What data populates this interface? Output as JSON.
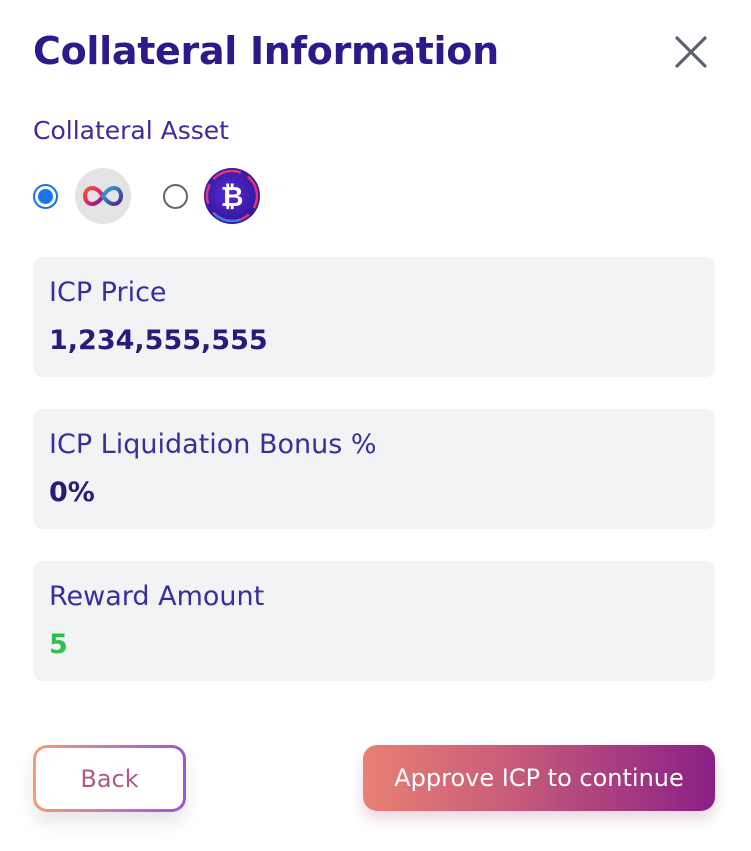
{
  "modal": {
    "title": "Collateral Information",
    "close_icon": "close-icon"
  },
  "collateral_asset": {
    "label": "Collateral Asset",
    "options": [
      {
        "icon": "icp-infinity-icon",
        "selected": true
      },
      {
        "icon": "ckbtc-bitcoin-icon",
        "selected": false
      }
    ]
  },
  "cards": [
    {
      "label": "ICP Price",
      "value": "1,234,555,555"
    },
    {
      "label": "ICP Liquidation Bonus %",
      "value": "0%"
    },
    {
      "label": "Reward Amount",
      "value": "5",
      "value_color": "#2ec24a"
    }
  ],
  "actions": {
    "back_label": "Back",
    "approve_label": "Approve ICP to continue"
  },
  "colors": {
    "title": "#2a1a8a",
    "radio_selected": "#1a73e8",
    "card_bg": "#f2f3f5"
  }
}
